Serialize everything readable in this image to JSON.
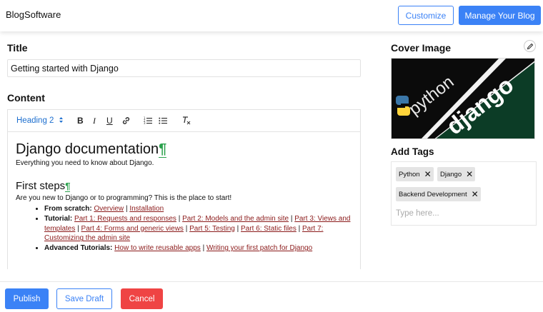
{
  "header": {
    "brand": "BlogSoftware",
    "customize_label": "Customize",
    "manage_label": "Manage Your Blog"
  },
  "form": {
    "title_label": "Title",
    "title_value": "Getting started with Django",
    "content_label": "Content"
  },
  "toolbar": {
    "heading_select": "Heading 2",
    "bold": "B",
    "italic": "I",
    "underline": "U"
  },
  "doc": {
    "h1": "Django documentation",
    "pilcrow": "¶",
    "intro": "Everything you need to know about Django.",
    "h2": "First steps",
    "p2": "Are you new to Django or to programming? This is the place to start!",
    "list": {
      "from_scratch_label": "From scratch:",
      "overview": "Overview",
      "installation": "Installation",
      "tutorial_label": "Tutorial:",
      "part1": "Part 1: Requests and responses",
      "part2": "Part 2: Models and the admin site",
      "part3": "Part 3: Views and templates",
      "part4": "Part 4: Forms and generic views",
      "part5": "Part 5: Testing",
      "part6": "Part 6: Static files",
      "part7": "Part 7: Customizing the admin site",
      "advanced_label": "Advanced Tutorials:",
      "reusable": "How to write reusable apps",
      "first_patch": "Writing your first patch for Django",
      "separator": "|"
    }
  },
  "sidebar": {
    "cover_label": "Cover Image",
    "cover_python_text": "python",
    "cover_django_text": "django",
    "tags_label": "Add Tags",
    "tags": [
      "Python",
      "Django",
      "Backend Development"
    ],
    "tag_placeholder": "Type here..."
  },
  "footer": {
    "publish_label": "Publish",
    "draft_label": "Save Draft",
    "cancel_label": "Cancel"
  },
  "colors": {
    "accent": "#3b82f6",
    "danger": "#ef4444",
    "pilcrow": "#2ba14c",
    "link": "#8b1a1a",
    "django_green": "#0c3c26"
  }
}
